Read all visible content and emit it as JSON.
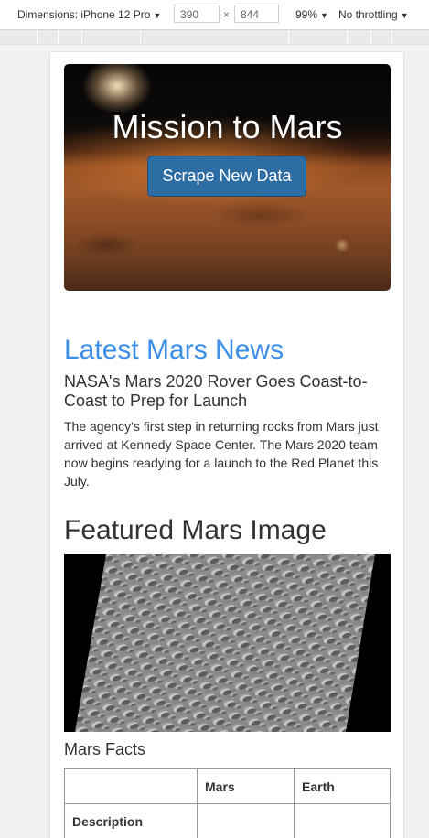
{
  "devtools": {
    "dimensions_label": "Dimensions: iPhone 12 Pro",
    "width": "390",
    "times": "×",
    "height": "844",
    "zoom": "99%",
    "throttling": "No throttling",
    "caret": "▼"
  },
  "jumbotron": {
    "title": "Mission to Mars",
    "button_label": "Scrape New Data"
  },
  "news": {
    "heading": "Latest Mars News",
    "title": "NASA's Mars 2020 Rover Goes Coast-to-Coast to Prep for Launch",
    "paragraph": "The agency's first step in returning rocks from Mars just arrived at Kennedy Space Center. The Mars 2020 team now begins readying for a launch to the Red Planet this July."
  },
  "featured": {
    "heading": "Featured Mars Image"
  },
  "facts": {
    "heading": "Mars Facts",
    "columns": [
      "",
      "Mars",
      "Earth"
    ],
    "rows": [
      [
        "Description",
        "",
        ""
      ]
    ]
  },
  "colors": {
    "news_heading": "#3d8ee8",
    "button": "#2e6da4"
  }
}
